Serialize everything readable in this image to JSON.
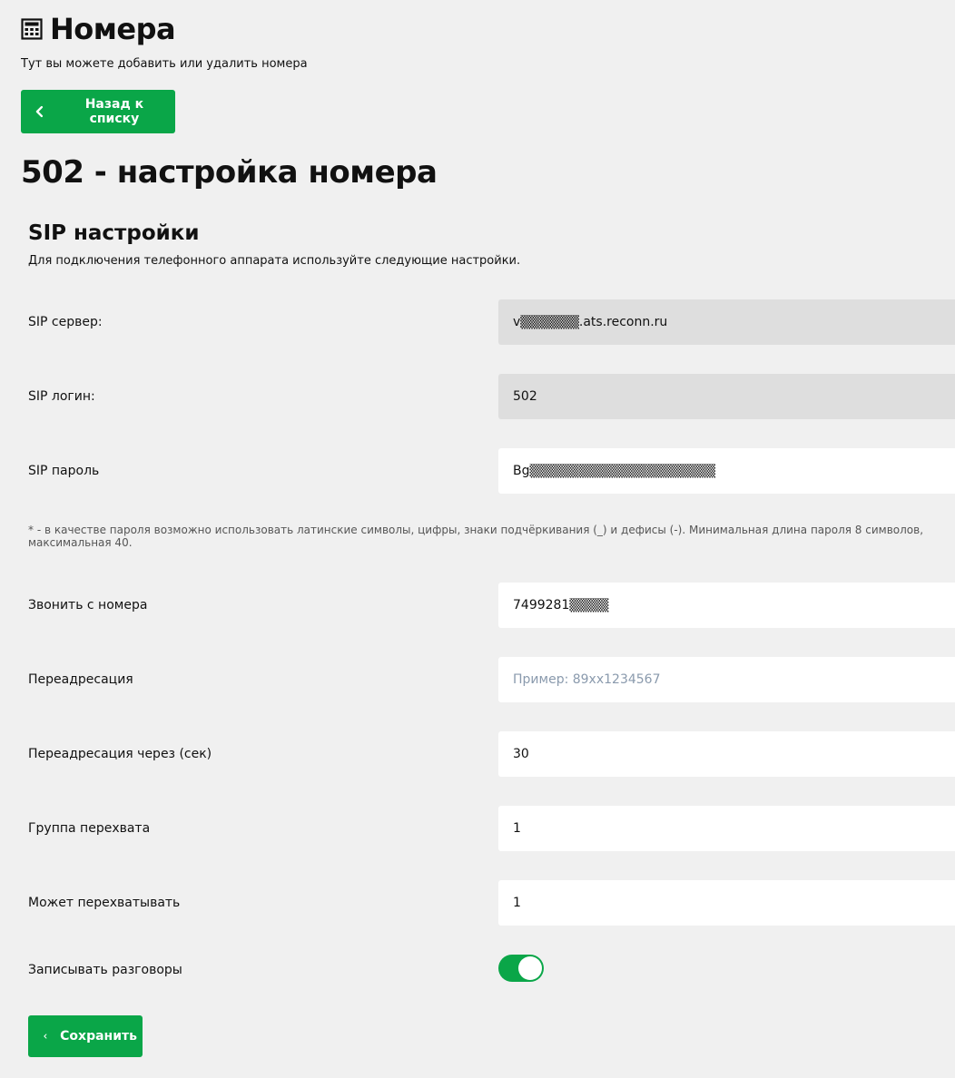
{
  "header": {
    "title": "Номера",
    "icon": "calculator-icon",
    "subtitle": "Тут вы можете добавить или удалить номера"
  },
  "back_button": {
    "label": "Назад к списку",
    "icon": "chevron-left-icon"
  },
  "section": {
    "title": "502 - настройка номера"
  },
  "sip": {
    "title": "SIP настройки",
    "description": "Для подключения телефонного аппарата используйте следующие настройки.",
    "server_label": "SIP сервер:",
    "server_value": "v▒▒▒▒▒▒.ats.reconn.ru",
    "login_label": "SIP логин:",
    "login_value": "502",
    "password_label": "SIP пароль",
    "password_value": "Bg▒▒▒▒▒▒▒▒▒▒▒▒▒▒▒▒▒▒▒",
    "password_note": "* - в качестве пароля возможно использовать латинские символы, цифры, знаки подчёркивания (_) и дефисы (-). Минимальная длина пароля 8 символов, максимальная 40."
  },
  "settings": {
    "call_from_label": "Звонить с номера",
    "call_from_value": "7499281▒▒▒▒",
    "redirect_label": "Переадресация",
    "redirect_placeholder": "Пример: 89xx1234567",
    "redirect_value": "",
    "redirect_delay_label": "Переадресация через (сек)",
    "redirect_delay_value": "30",
    "pickup_group_label": "Группа перехвата",
    "pickup_group_value": "1",
    "can_pickup_label": "Может перехватывать",
    "can_pickup_value": "1",
    "record_label": "Записывать разговоры",
    "record_enabled": true
  },
  "save_button": {
    "label": "Сохранить",
    "icon": "chevron-left-icon"
  },
  "colors": {
    "accent": "#0aa648",
    "background": "#f0f0f0",
    "readonly_field": "#dedede",
    "placeholder": "#8a9aad"
  }
}
